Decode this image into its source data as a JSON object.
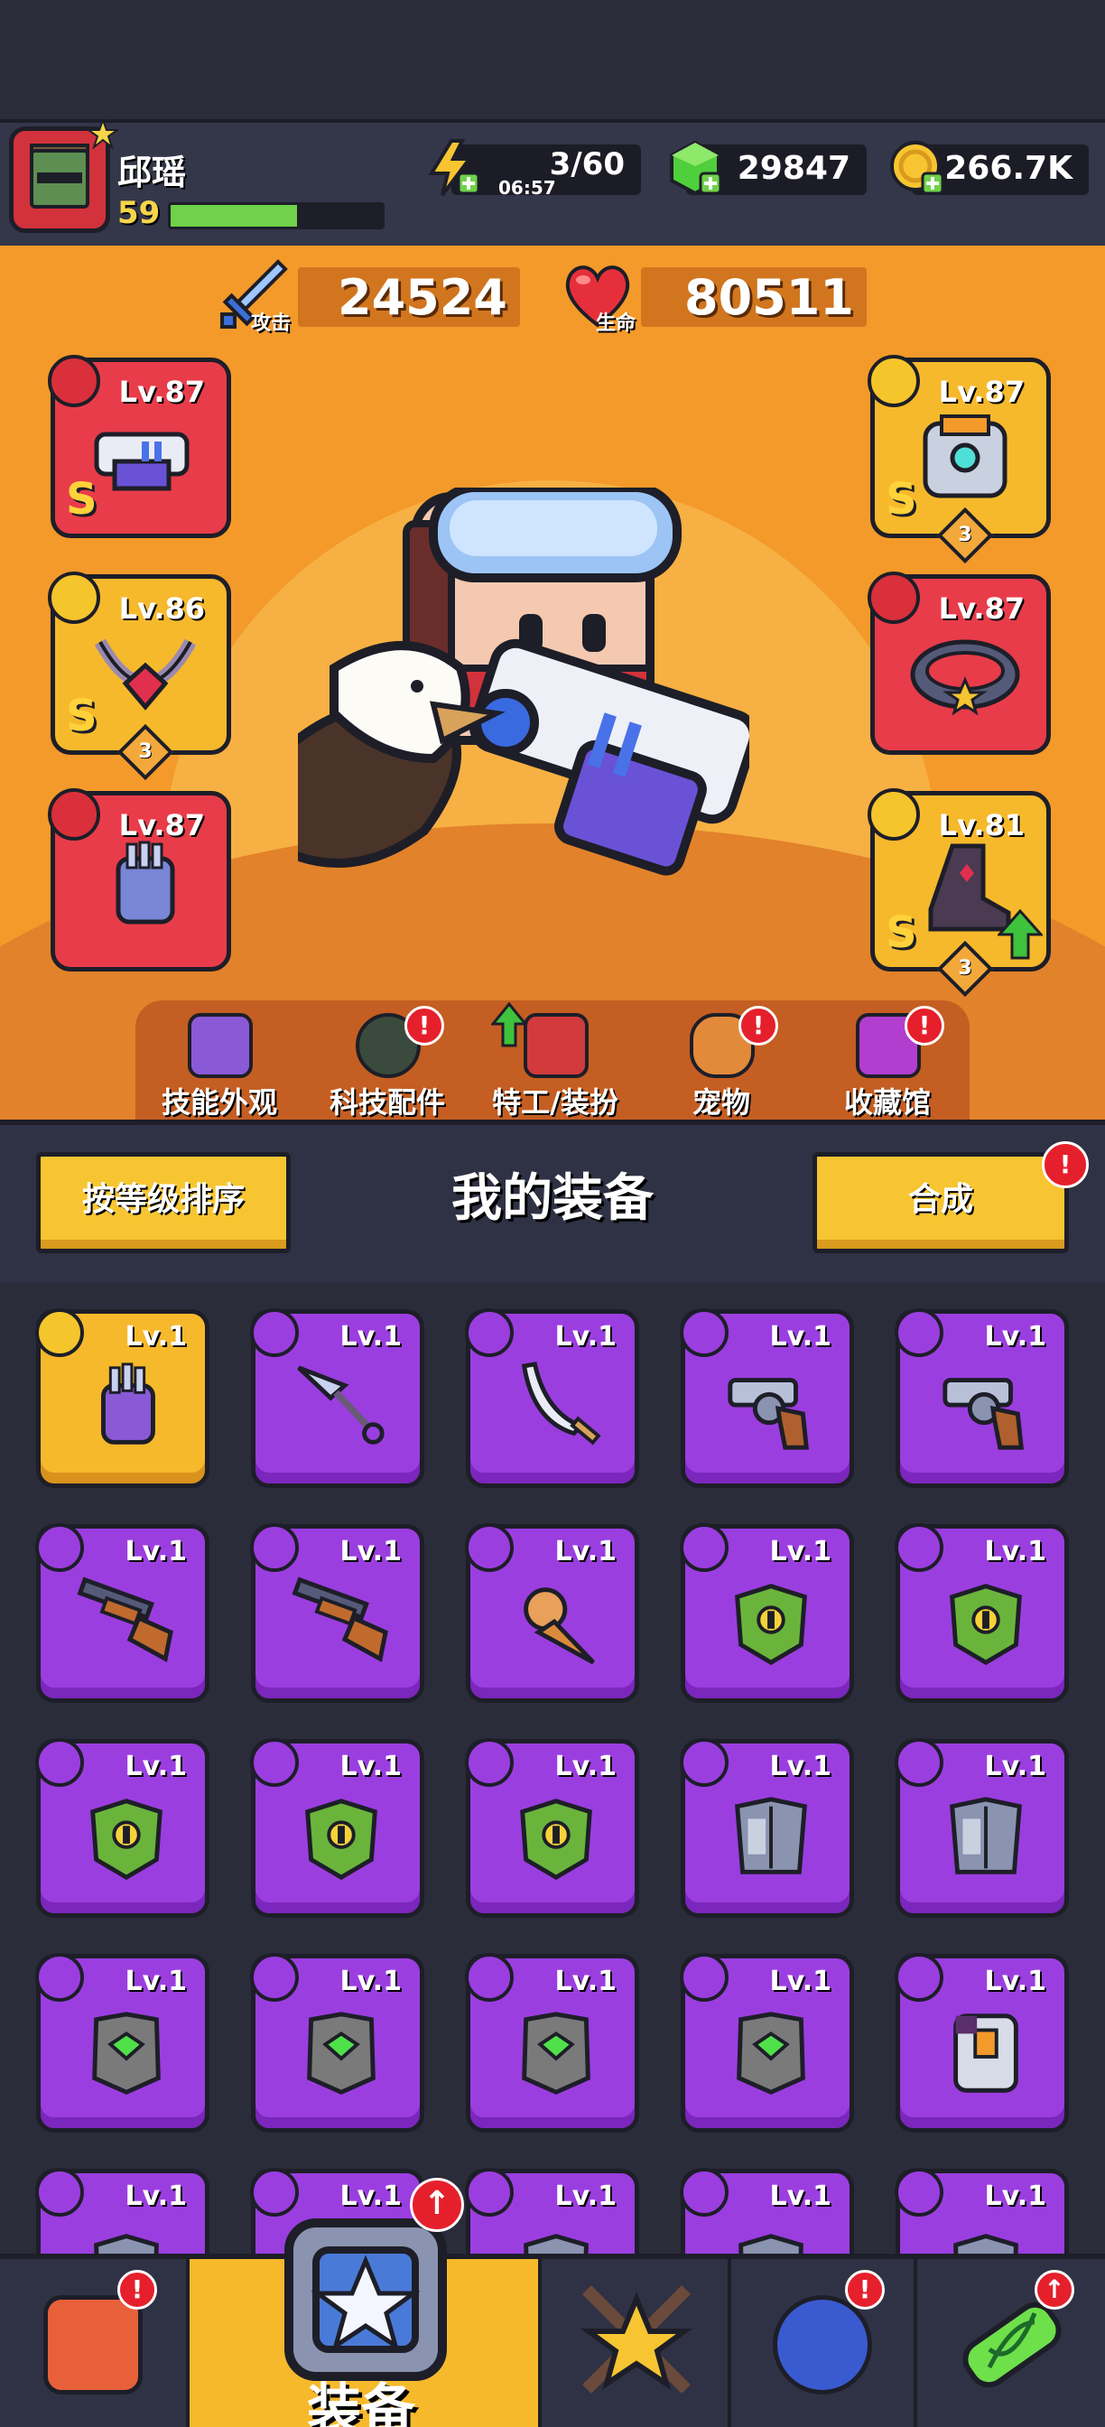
{
  "player": {
    "name": "邱瑶",
    "level": "59",
    "xp_fraction": 0.6
  },
  "resources": {
    "energy": "3/60",
    "energy_timer": "06:57",
    "gems": "29847",
    "coins": "266.7K"
  },
  "stats": {
    "attack_value": "24524",
    "attack_label": "攻击",
    "hp_value": "80511",
    "hp_label": "生命"
  },
  "slots": [
    {
      "level": "Lv.87",
      "rank": "S",
      "stars": "",
      "category_icon": "weapon-icon",
      "color": "#e83c4a"
    },
    {
      "level": "Lv.86",
      "rank": "S",
      "stars": "3",
      "category_icon": "necklace-icon",
      "color": "#f6b92c"
    },
    {
      "level": "Lv.87",
      "rank": "",
      "stars": "",
      "category_icon": "glove-icon",
      "color": "#e83c4a"
    },
    {
      "level": "Lv.87",
      "rank": "S",
      "stars": "3",
      "category_icon": "armor-icon",
      "color": "#f6b92c"
    },
    {
      "level": "Lv.87",
      "rank": "",
      "stars": "",
      "category_icon": "belt-icon",
      "color": "#e83c4a"
    },
    {
      "level": "Lv.81",
      "rank": "S",
      "stars": "3",
      "category_icon": "boot-icon",
      "color": "#f6b92c"
    }
  ],
  "nav": {
    "skins": "技能外观",
    "tech": "科技配件",
    "agent": "特工/装扮",
    "pets": "宠物",
    "collection": "收藏馆",
    "badge": "!"
  },
  "inventory": {
    "sort_label": "按等级排序",
    "title": "我的装备",
    "merge_label": "合成",
    "items": [
      {
        "level": "Lv.1",
        "item": "gauntlet",
        "rarity": "gold"
      },
      {
        "level": "Lv.1",
        "item": "kunai",
        "rarity": "purple"
      },
      {
        "level": "Lv.1",
        "item": "scimitar",
        "rarity": "purple"
      },
      {
        "level": "Lv.1",
        "item": "revolver",
        "rarity": "purple"
      },
      {
        "level": "Lv.1",
        "item": "revolver",
        "rarity": "purple"
      },
      {
        "level": "Lv.1",
        "item": "shotgun",
        "rarity": "purple"
      },
      {
        "level": "Lv.1",
        "item": "shotgun",
        "rarity": "purple"
      },
      {
        "level": "Lv.1",
        "item": "ice-cream-cone",
        "rarity": "purple"
      },
      {
        "level": "Lv.1",
        "item": "dragon-armor",
        "rarity": "purple"
      },
      {
        "level": "Lv.1",
        "item": "dragon-armor",
        "rarity": "purple"
      },
      {
        "level": "Lv.1",
        "item": "dragon-armor",
        "rarity": "purple"
      },
      {
        "level": "Lv.1",
        "item": "dragon-armor",
        "rarity": "purple"
      },
      {
        "level": "Lv.1",
        "item": "dragon-armor",
        "rarity": "purple"
      },
      {
        "level": "Lv.1",
        "item": "steel-armor",
        "rarity": "purple"
      },
      {
        "level": "Lv.1",
        "item": "steel-armor",
        "rarity": "purple"
      },
      {
        "level": "Lv.1",
        "item": "gem-vest",
        "rarity": "purple"
      },
      {
        "level": "Lv.1",
        "item": "gem-vest",
        "rarity": "purple"
      },
      {
        "level": "Lv.1",
        "item": "gem-vest",
        "rarity": "purple"
      },
      {
        "level": "Lv.1",
        "item": "gem-vest",
        "rarity": "purple"
      },
      {
        "level": "Lv.1",
        "item": "plate-armor",
        "rarity": "purple"
      },
      {
        "level": "Lv.1",
        "item": "armor",
        "rarity": "purple"
      },
      {
        "level": "Lv.1",
        "item": "armor",
        "rarity": "purple"
      },
      {
        "level": "Lv.1",
        "item": "armor",
        "rarity": "purple"
      },
      {
        "level": "Lv.1",
        "item": "armor",
        "rarity": "purple"
      },
      {
        "level": "Lv.1",
        "item": "armor",
        "rarity": "purple"
      }
    ]
  },
  "bottom_nav": {
    "equip_label": "装备",
    "badge": "!",
    "upgrade_badge": "↑"
  },
  "colors": {
    "stage": "#f39a2a",
    "purple": "#9b3ee0",
    "gold": "#f6b92c",
    "red": "#e83c4a"
  }
}
